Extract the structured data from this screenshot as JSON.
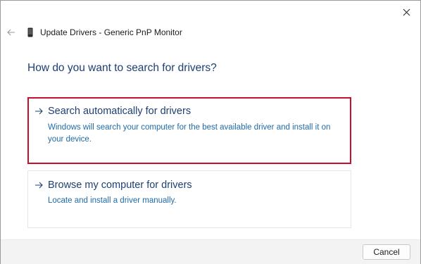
{
  "window": {
    "title": "Update Drivers - Generic PnP Monitor",
    "close_icon": "close-icon",
    "back_icon": "back-arrow-icon",
    "device_icon": "device-icon"
  },
  "main": {
    "heading": "How do you want to search for drivers?",
    "options": [
      {
        "title": "Search automatically for drivers",
        "description": "Windows will search your computer for the best available driver and install it on your device.",
        "icon": "arrow-right-icon",
        "highlighted": true
      },
      {
        "title": "Browse my computer for drivers",
        "description": "Locate and install a driver manually.",
        "icon": "arrow-right-icon",
        "highlighted": false
      }
    ]
  },
  "footer": {
    "cancel_label": "Cancel"
  },
  "colors": {
    "heading": "#1d3f72",
    "description": "#1e6aa8",
    "highlight_border": "#c8102e",
    "footer_bg": "#f3f3f3"
  }
}
